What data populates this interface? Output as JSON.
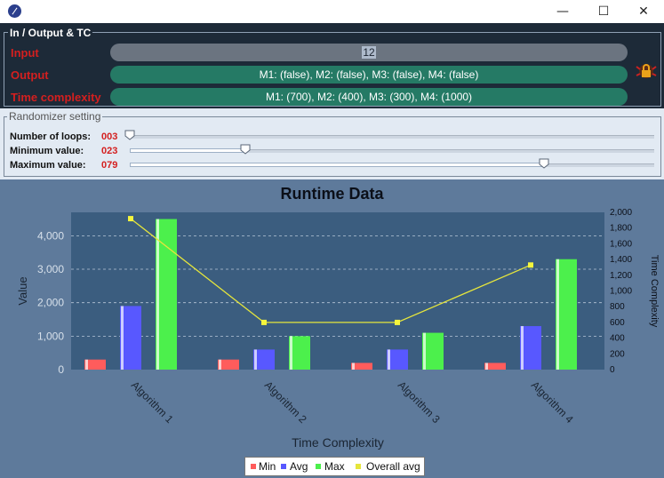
{
  "window": {
    "app_icon": "compass-icon",
    "controls": {
      "minimize": "—",
      "maximize": "☐",
      "close": "✕"
    }
  },
  "io_section": {
    "title": "In / Output & TC",
    "input_label": "Input",
    "input_value": "12",
    "output_label": "Output",
    "output_value": "M1: (false), M2: (false), M3: (false), M4: (false)",
    "tc_label": "Time complexity",
    "tc_value": "M1: (700), M2: (400), M3: (300), M4: (1000)",
    "lock_icon": "lock-icon"
  },
  "randomizer": {
    "title": "Randomizer setting",
    "loops_label": "Number of loops:",
    "loops_value": "003",
    "min_label": "Minimum value:",
    "min_value": "023",
    "max_label": "Maximum value:",
    "max_value": "079",
    "loops_fraction": 0.0,
    "min_fraction": 0.22,
    "max_fraction": 0.79
  },
  "chart_data": {
    "type": "bar",
    "title": "Runtime Data",
    "xlabel": "Time Complexity",
    "ylabel": "Value",
    "y2label": "Time Complexity",
    "categories": [
      "Algorithm 1",
      "Algorithm 2",
      "Algorithm 3",
      "Algorithm 4"
    ],
    "ylim": [
      0,
      4700
    ],
    "y2lim": [
      0,
      2000
    ],
    "yticks": [
      "0",
      "1,000",
      "2,000",
      "3,000",
      "4,000"
    ],
    "y2ticks": [
      "0",
      "200",
      "400",
      "600",
      "800",
      "1,000",
      "1,200",
      "1,400",
      "1,600",
      "1,800",
      "2,000"
    ],
    "series": [
      {
        "name": "Min",
        "values": [
          300,
          300,
          200,
          200
        ],
        "color": "#ff5c5c"
      },
      {
        "name": "Avg",
        "values": [
          1900,
          600,
          600,
          1300
        ],
        "color": "#5858ff"
      },
      {
        "name": "Max",
        "values": [
          4500,
          1000,
          1100,
          3300
        ],
        "color": "#4cf04c"
      }
    ],
    "line_series": {
      "name": "Overall avg",
      "values": [
        1920,
        600,
        600,
        1330
      ],
      "color": "#e6e63c"
    },
    "grid": true,
    "legend": "bottom-center"
  }
}
